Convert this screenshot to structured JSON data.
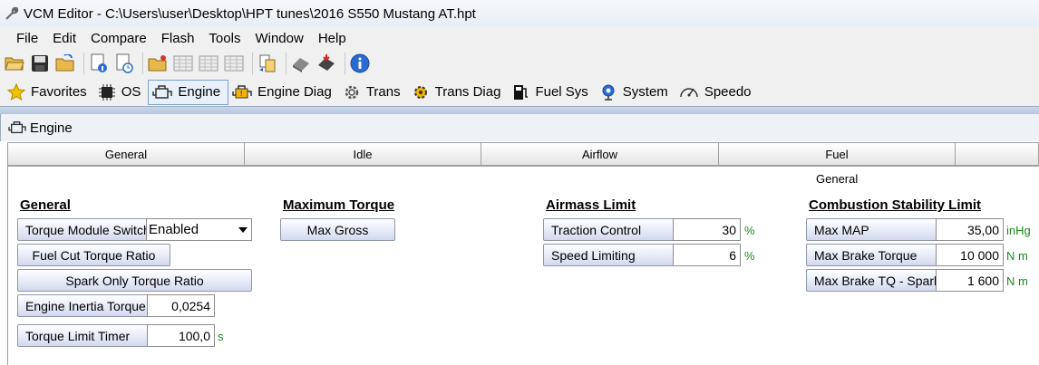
{
  "window": {
    "title": "VCM Editor - C:\\Users\\user\\Desktop\\HPT tunes\\2016 S550 Mustang AT.hpt"
  },
  "menu": [
    "File",
    "Edit",
    "Compare",
    "Flash",
    "Tools",
    "Window",
    "Help"
  ],
  "toolbar": {
    "icons": [
      "open-icon",
      "save-icon",
      "save-as-icon",
      "file-info-icon",
      "file-history-icon",
      "open-folder-icon",
      "table-icon",
      "table-icon",
      "table-icon",
      "compare-icon",
      "read-vehicle-icon",
      "write-vehicle-icon",
      "info-icon"
    ]
  },
  "modules": [
    {
      "label": "Favorites",
      "icon": "star-icon"
    },
    {
      "label": "OS",
      "icon": "chip-icon"
    },
    {
      "label": "Engine",
      "icon": "engine-icon"
    },
    {
      "label": "Engine Diag",
      "icon": "engine-diag-icon"
    },
    {
      "label": "Trans",
      "icon": "gear-icon"
    },
    {
      "label": "Trans Diag",
      "icon": "trans-diag-icon"
    },
    {
      "label": "Fuel Sys",
      "icon": "fuel-pump-icon"
    },
    {
      "label": "System",
      "icon": "system-icon"
    },
    {
      "label": "Speedo",
      "icon": "speedometer-icon"
    }
  ],
  "active_module": "Engine",
  "panel": {
    "title": "Engine"
  },
  "subtabs": [
    "General",
    "Idle",
    "Airflow",
    "Fuel"
  ],
  "section_caption": "General",
  "general": {
    "heading": "General",
    "torque_module_switch": {
      "label": "Torque Module Switch",
      "value": "Enabled"
    },
    "fuel_cut_torque_ratio": "Fuel Cut Torque Ratio",
    "spark_only_torque_ratio": "Spark Only Torque Ratio",
    "engine_inertia_torque": {
      "label": "Engine Inertia Torque",
      "value": "0,0254"
    },
    "torque_limit_timer": {
      "label": "Torque Limit Timer",
      "value": "100,0",
      "unit": "s"
    }
  },
  "max_torque": {
    "heading": "Maximum Torque",
    "max_gross": "Max Gross"
  },
  "airmass_limit": {
    "heading": "Airmass Limit",
    "traction_control": {
      "label": "Traction Control",
      "value": "30",
      "unit": "%"
    },
    "speed_limiting": {
      "label": "Speed Limiting",
      "value": "6",
      "unit": "%"
    }
  },
  "combustion": {
    "heading": "Combustion Stability Limit",
    "max_map": {
      "label": "Max MAP",
      "value": "35,00",
      "unit": "inHg"
    },
    "max_brake_torque": {
      "label": "Max Brake Torque",
      "value": "10 000",
      "unit": "N m"
    },
    "max_brake_tq_spark": {
      "label": "Max Brake TQ - Spark",
      "value": "1 600",
      "unit": "N m"
    }
  }
}
